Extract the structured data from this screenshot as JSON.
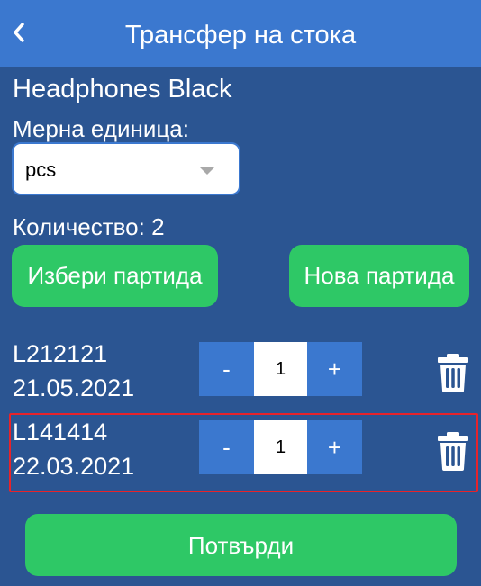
{
  "header": {
    "title": "Трансфер на стока",
    "back_icon": "chevron-left-icon"
  },
  "product": {
    "name": "Headphones Black"
  },
  "unit": {
    "label": "Мерна единица:",
    "selected": "pcs"
  },
  "quantity": {
    "text": "Количество: 2"
  },
  "actions": {
    "choose_batch": "Избери партида",
    "new_batch": "Нова партида",
    "confirm": "Потвърди"
  },
  "batches": [
    {
      "code": "L212121",
      "date": "21.05.2021",
      "minus": "-",
      "plus": "+",
      "qty": "1",
      "highlighted": false
    },
    {
      "code": "L141414",
      "date": "22.03.2021",
      "minus": "-",
      "plus": "+",
      "qty": "1",
      "highlighted": true
    }
  ],
  "colors": {
    "background": "#2b5592",
    "header": "#3b78cf",
    "green": "#2ec866",
    "highlight": "#e8232a"
  }
}
